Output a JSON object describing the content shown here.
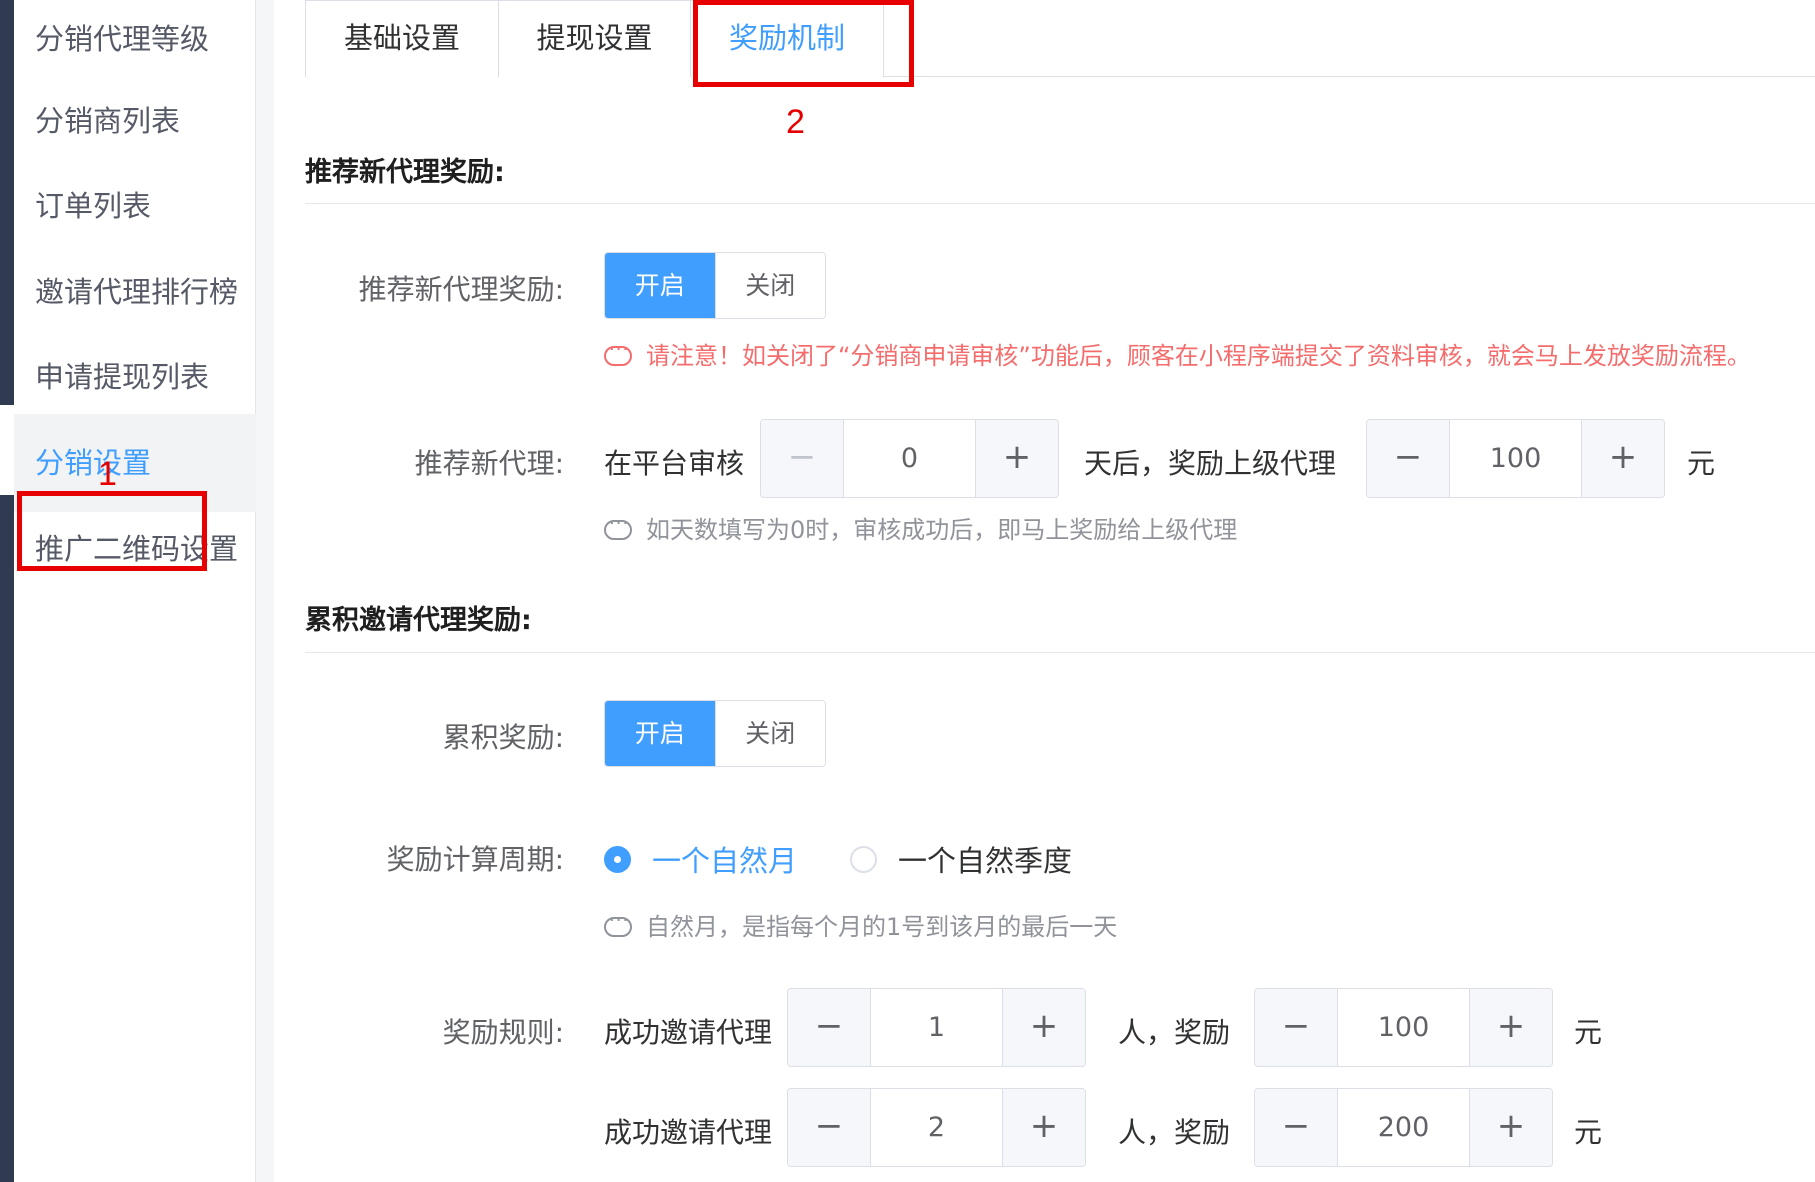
{
  "sidebar": {
    "items": [
      {
        "label": "分销代理等级"
      },
      {
        "label": "分销商列表"
      },
      {
        "label": "订单列表"
      },
      {
        "label": "邀请代理排行榜"
      },
      {
        "label": "申请提现列表"
      },
      {
        "label": "分销设置",
        "active": true
      },
      {
        "label": "推广二维码设置"
      }
    ]
  },
  "tabs": [
    {
      "label": "基础设置"
    },
    {
      "label": "提现设置"
    },
    {
      "label": "奖励机制",
      "active": true
    }
  ],
  "annotations": {
    "one": "1",
    "two": "2"
  },
  "recommend": {
    "section_title": "推荐新代理奖励:",
    "switch_label": "推荐新代理奖励:",
    "switch_on": "开启",
    "switch_off": "关闭",
    "warning": "请注意！如关闭了“分销商申请审核”功能后，顾客在小程序端提交了资料审核，就会马上发放奖励流程。",
    "row_label": "推荐新代理:",
    "prefix": "在平台审核",
    "days_value": "0",
    "middle": "天后，奖励上级代理",
    "amount_value": "100",
    "unit": "元",
    "hint": "如天数填写为0时，审核成功后，即马上奖励给上级代理"
  },
  "cumulative": {
    "section_title": "累积邀请代理奖励:",
    "switch_label": "累积奖励:",
    "switch_on": "开启",
    "switch_off": "关闭",
    "period_label": "奖励计算周期:",
    "period_options": [
      "一个自然月",
      "一个自然季度"
    ],
    "period_selected": "一个自然月",
    "period_hint": "自然月，是指每个月的1号到该月的最后一天",
    "rules_label": "奖励规则:",
    "rule_prefix": "成功邀请代理",
    "rule_middle": "人，奖励",
    "rule_unit": "元",
    "rules": [
      {
        "count": "1",
        "amount": "100"
      },
      {
        "count": "2",
        "amount": "200"
      }
    ]
  },
  "stepper": {
    "minus": "−",
    "plus": "+"
  },
  "colors": {
    "accent": "#409eff",
    "warning": "#f56c6c",
    "annotation": "#e60000",
    "sidebar_dark": "#303a50"
  }
}
